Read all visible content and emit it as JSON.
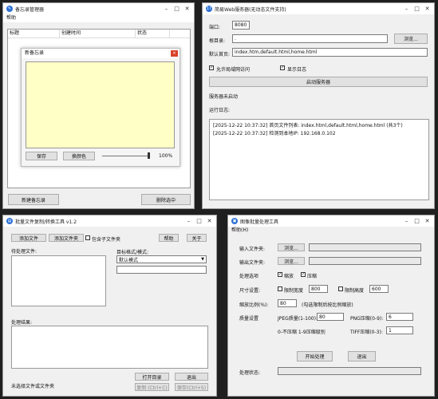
{
  "memo": {
    "title": "备忘录管理器",
    "menu_help": "帮助",
    "columns": [
      "标题",
      "创建时间",
      "状态"
    ],
    "dialog_title": "新备忘录",
    "save_label": "保存",
    "color_label": "换颜色",
    "opacity": "100%",
    "new_label": "新建备忘录",
    "delete_label": "删除选中"
  },
  "web": {
    "title": "简易Web服务器(无动态文件支持)",
    "port_label": "端口:",
    "port_value": "8080",
    "root_label": "根目录:",
    "root_value": ".",
    "browse_label": "浏览...",
    "default_label": "默认首页:",
    "default_value": "index.htm,default.html,home.html",
    "lan_label": "允许局域网访问",
    "log_label": "显示日志",
    "start_label": "启动服务器",
    "status_text": "服务器未启动",
    "log_title": "运行日志:",
    "log_lines": [
      "[2025-12-22 10:37:32] 首页文件列表: index.html,default.html,home.html (共3个)",
      "[2025-12-22 10:37:32] 检测到本地IP: 192.168.0.102"
    ]
  },
  "split": {
    "title": "批量文件复制/转换工具 v1.2",
    "btn1": "添加文件",
    "btn2": "添加文件夹",
    "opt_label": "包含子文件夹",
    "help": "帮助",
    "about": "关于",
    "list_label": "待处理文件:",
    "mode_label": "目标格式/模式:",
    "mode_value": "默认模式",
    "result_label": "处理结果:",
    "status_label": "未选择文件或文件夹",
    "open_label": "打开目录",
    "exit_label": "退出",
    "copy_label": "复制 (Ctrl+C)",
    "save_label": "保存(Ctrl+S)"
  },
  "img": {
    "title": "图像批量处理工具",
    "menu": "帮助(H)",
    "input_label": "输入文件夹:",
    "input_btn": "浏览...",
    "output_label": "输出文件夹:",
    "output_btn": "浏览...",
    "mode_label": "处理选项",
    "mode_opt1": "缩放",
    "mode_opt2": "压缩",
    "size_label": "尺寸设置:",
    "w_label": "限制宽度",
    "w_value": "800",
    "h_label": "限制高度",
    "h_value": "600",
    "ratio_label": "缩放比例(%):",
    "ratio_value": "80",
    "ratio_hint": "(勾选限制后按比例缩放)",
    "quality_label": "质量设置",
    "jpeg_label": "JPEG质量(1-100):",
    "jpeg_value": "80",
    "png_label": "PNG压缩(0-9):",
    "png_value": "6",
    "webp_label": "0-不压缩 1-9压缩级别",
    "tiff_label": "TIFF压缩(0-3):",
    "tiff_value": "1",
    "start_btn": "开始处理",
    "exit_btn": "退出",
    "status_label": "处理状态:"
  }
}
